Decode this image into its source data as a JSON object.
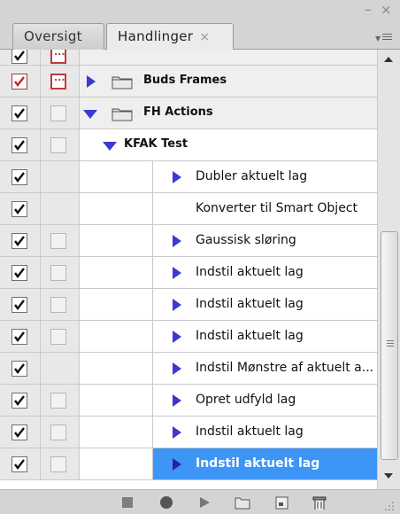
{
  "window": {
    "minimize_glyph": "–",
    "close_glyph": "×"
  },
  "tabs": [
    {
      "label": "Oversigt",
      "active": false
    },
    {
      "label": "Handlinger",
      "active": true,
      "close_glyph": "×"
    }
  ],
  "rows": [
    {
      "kind": "set",
      "label": "",
      "checked": true,
      "dialog": "red-partial",
      "partial": true
    },
    {
      "kind": "set",
      "label": "Buds Frames",
      "checked": true,
      "check_color": "#cc2222",
      "dialog": "red",
      "expanded": false
    },
    {
      "kind": "set",
      "label": "FH Actions",
      "checked": true,
      "dialog": "empty",
      "expanded": true
    },
    {
      "kind": "action",
      "label": "KFAK Test",
      "checked": true,
      "dialog": "empty",
      "expanded": true
    },
    {
      "kind": "step",
      "label": "Dubler aktuelt lag",
      "checked": true,
      "dialog": "none",
      "has_triangle": true
    },
    {
      "kind": "step",
      "label": "Konverter til Smart Object",
      "checked": true,
      "dialog": "none",
      "has_triangle": false
    },
    {
      "kind": "step",
      "label": "Gaussisk sløring",
      "checked": true,
      "dialog": "empty",
      "has_triangle": true
    },
    {
      "kind": "step",
      "label": "Indstil aktuelt lag",
      "checked": true,
      "dialog": "empty",
      "has_triangle": true
    },
    {
      "kind": "step",
      "label": "Indstil aktuelt lag",
      "checked": true,
      "dialog": "empty",
      "has_triangle": true
    },
    {
      "kind": "step",
      "label": "Indstil aktuelt lag",
      "checked": true,
      "dialog": "empty",
      "has_triangle": true
    },
    {
      "kind": "step",
      "label": "Indstil Mønstre af aktuelt a...",
      "checked": true,
      "dialog": "none",
      "has_triangle": true
    },
    {
      "kind": "step",
      "label": "Opret udfyld lag",
      "checked": true,
      "dialog": "empty",
      "has_triangle": true
    },
    {
      "kind": "step",
      "label": "Indstil aktuelt lag",
      "checked": true,
      "dialog": "empty",
      "has_triangle": true
    },
    {
      "kind": "step",
      "label": "Indstil aktuelt lag",
      "checked": true,
      "dialog": "empty",
      "has_triangle": true,
      "selected": true
    }
  ],
  "colors": {
    "selection": "#3d95f5",
    "triangle": "#3a3ad0",
    "checkmark_red": "#cc2222"
  },
  "toolbar": {
    "buttons": [
      "stop-icon",
      "record-icon",
      "play-icon",
      "folder-icon",
      "new-action-icon",
      "trash-icon"
    ]
  }
}
